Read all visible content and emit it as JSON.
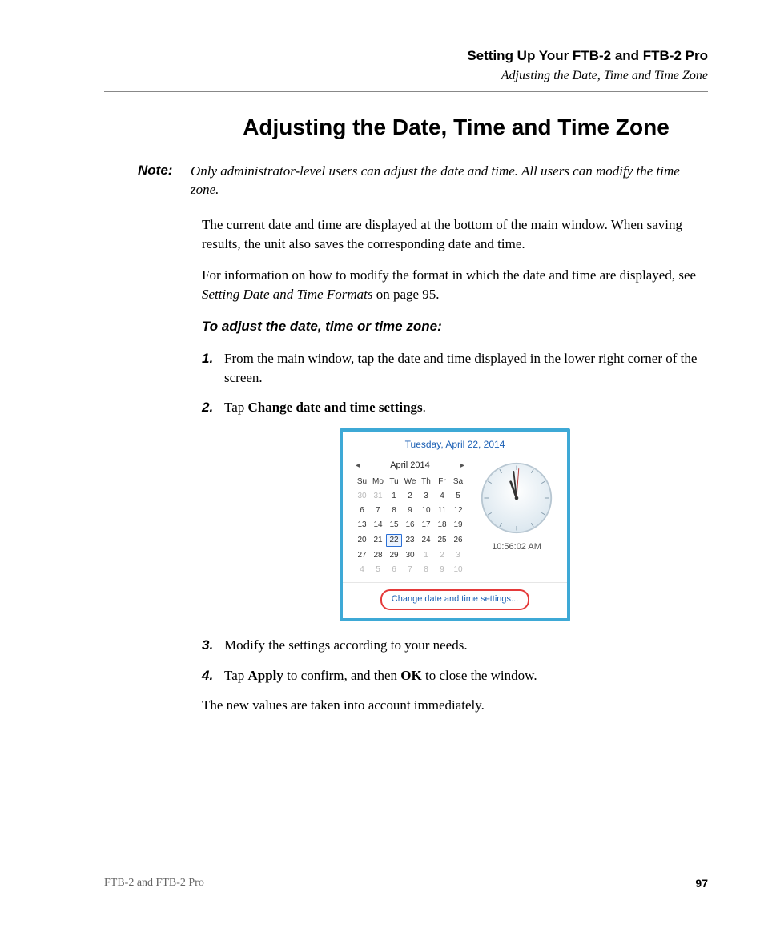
{
  "header": {
    "chapter": "Setting Up Your FTB-2 and FTB-2 Pro",
    "section": "Adjusting the Date, Time and Time Zone"
  },
  "title": "Adjusting the Date, Time and Time Zone",
  "note": {
    "label": "Note:",
    "text": "Only administrator-level users can adjust the date and time. All users can modify the time zone."
  },
  "paras": {
    "p1": "The current date and time are displayed at the bottom of the main window. When saving results, the unit also saves the corresponding date and time.",
    "p2a": "For information on how to modify the format in which the date and time are displayed, see ",
    "p2_ref": "Setting Date and Time Formats",
    "p2b": " on page 95."
  },
  "procedure_heading": "To adjust the date, time or time zone:",
  "steps": {
    "s1_num": "1.",
    "s1": "From the main window, tap the date and time displayed in the lower right corner of the screen.",
    "s2_num": "2.",
    "s2a": "Tap ",
    "s2_kw": "Change date and time settings",
    "s2b": ".",
    "s3_num": "3.",
    "s3": "Modify the settings according to your needs.",
    "s4_num": "4.",
    "s4a": "Tap ",
    "s4_kw1": "Apply",
    "s4b": " to confirm, and then ",
    "s4_kw2": "OK",
    "s4c": " to close the window."
  },
  "closing": "The new values are taken into account immediately.",
  "popup": {
    "full_date": "Tuesday, April 22, 2014",
    "month_label": "April 2014",
    "prev_glyph": "◂",
    "next_glyph": "▸",
    "dow": [
      "Su",
      "Mo",
      "Tu",
      "We",
      "Th",
      "Fr",
      "Sa"
    ],
    "weeks": [
      [
        {
          "v": "30",
          "o": true
        },
        {
          "v": "31",
          "o": true
        },
        {
          "v": "1"
        },
        {
          "v": "2"
        },
        {
          "v": "3"
        },
        {
          "v": "4"
        },
        {
          "v": "5"
        }
      ],
      [
        {
          "v": "6"
        },
        {
          "v": "7"
        },
        {
          "v": "8"
        },
        {
          "v": "9"
        },
        {
          "v": "10"
        },
        {
          "v": "11"
        },
        {
          "v": "12"
        }
      ],
      [
        {
          "v": "13"
        },
        {
          "v": "14"
        },
        {
          "v": "15"
        },
        {
          "v": "16"
        },
        {
          "v": "17"
        },
        {
          "v": "18"
        },
        {
          "v": "19"
        }
      ],
      [
        {
          "v": "20"
        },
        {
          "v": "21"
        },
        {
          "v": "22",
          "sel": true
        },
        {
          "v": "23"
        },
        {
          "v": "24"
        },
        {
          "v": "25"
        },
        {
          "v": "26"
        }
      ],
      [
        {
          "v": "27"
        },
        {
          "v": "28"
        },
        {
          "v": "29"
        },
        {
          "v": "30"
        },
        {
          "v": "1",
          "o": true
        },
        {
          "v": "2",
          "o": true
        },
        {
          "v": "3",
          "o": true
        }
      ],
      [
        {
          "v": "4",
          "o": true
        },
        {
          "v": "5",
          "o": true
        },
        {
          "v": "6",
          "o": true
        },
        {
          "v": "7",
          "o": true
        },
        {
          "v": "8",
          "o": true
        },
        {
          "v": "9",
          "o": true
        },
        {
          "v": "10",
          "o": true
        }
      ]
    ],
    "time_label": "10:56:02 AM",
    "change_link": "Change date and time settings..."
  },
  "footer": {
    "product": "FTB-2 and FTB-2 Pro",
    "page": "97"
  }
}
